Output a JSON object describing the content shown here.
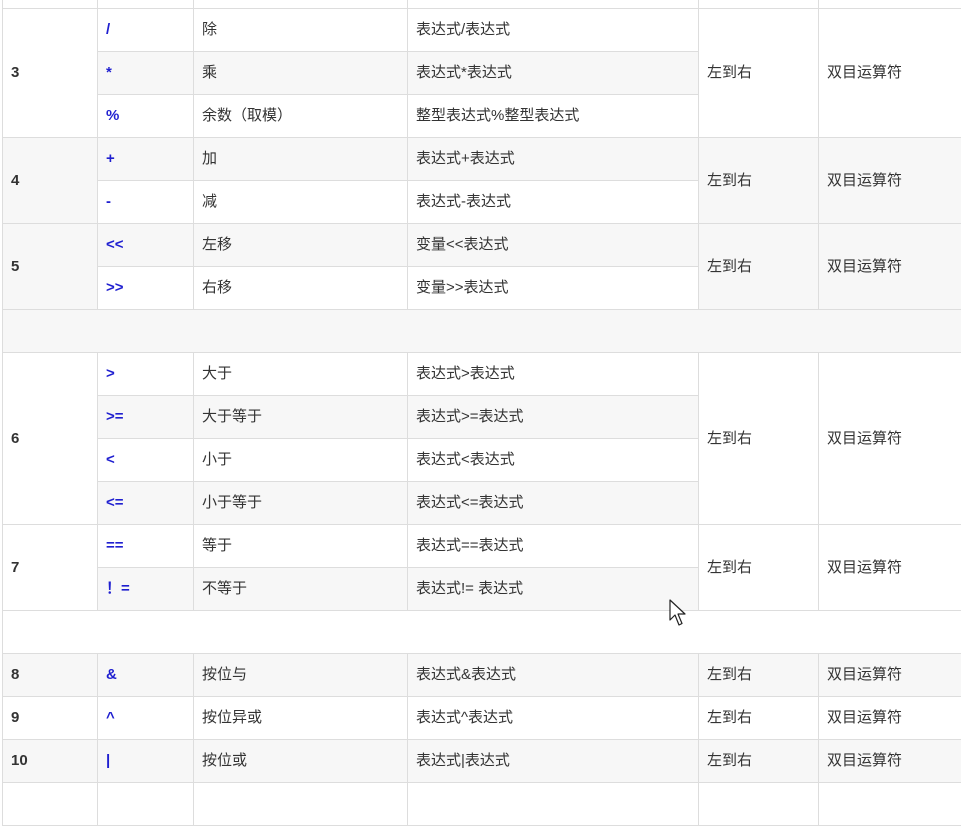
{
  "rows": [
    {
      "level": "3",
      "op": "/",
      "name": "除",
      "form": "表达式/表达式",
      "assoc": "左到右",
      "type": "双目运算符"
    },
    {
      "op": "*",
      "name": "乘",
      "form": "表达式*表达式"
    },
    {
      "op": "%",
      "name": "余数（取模）",
      "form": "整型表达式%整型表达式"
    },
    {
      "level": "4",
      "op": "+",
      "name": "加",
      "form": "表达式+表达式",
      "assoc": "左到右",
      "type": "双目运算符"
    },
    {
      "op": "-",
      "name": "减",
      "form": "表达式-表达式"
    },
    {
      "level": "5",
      "op": "<<",
      "name": "左移",
      "form": "变量<<表达式",
      "assoc": "左到右",
      "type": "双目运算符"
    },
    {
      "op": ">>",
      "name": "右移",
      "form": "变量>>表达式"
    },
    {
      "level": "6",
      "op": ">",
      "name": "大于",
      "form": "表达式>表达式",
      "assoc": "左到右",
      "type": "双目运算符"
    },
    {
      "op": ">=",
      "name": "大于等于",
      "form": "表达式>=表达式"
    },
    {
      "op": "<",
      "name": "小于",
      "form": "表达式<表达式"
    },
    {
      "op": "<=",
      "name": "小于等于",
      "form": "表达式<=表达式"
    },
    {
      "level": "7",
      "op": "==",
      "name": "等于",
      "form": "表达式==表达式",
      "assoc": "左到右",
      "type": "双目运算符"
    },
    {
      "op": "！=",
      "name": "不等于",
      "form": "表达式!= 表达式"
    },
    {
      "level": "8",
      "op": "&",
      "name": "按位与",
      "form": "表达式&表达式",
      "assoc": "左到右",
      "type": "双目运算符"
    },
    {
      "level": "9",
      "op": "^",
      "name": "按位异或",
      "form": "表达式^表达式",
      "assoc": "左到右",
      "type": "双目运算符"
    },
    {
      "level": "10",
      "op": "|",
      "name": "按位或",
      "form": "表达式|表达式",
      "assoc": "左到右",
      "type": "双目运算符"
    }
  ],
  "icons": {
    "cursor": "mouse-pointer-icon"
  }
}
